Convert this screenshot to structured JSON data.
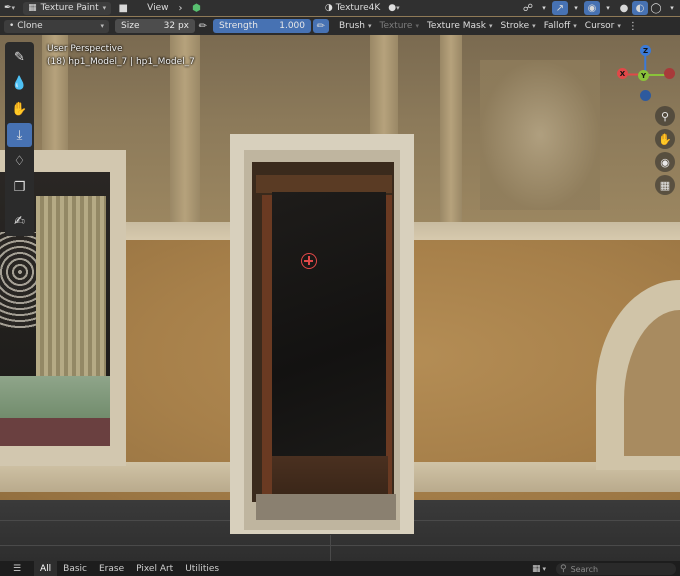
{
  "header": {
    "editor_type_icon": "brush-editor-icon",
    "mode_label": "Texture Paint",
    "view_menu": "View",
    "texture_name": "Texture4K",
    "icons": [
      "orientation-icon",
      "snap-icon",
      "overlay-icon",
      "shading-solid-icon",
      "shading-material-icon",
      "shading-rendered-icon"
    ]
  },
  "tool_header": {
    "brush_name": "Clone",
    "size_label": "Size",
    "size_value": "32 px",
    "strength_label": "Strength",
    "strength_value": "1.000",
    "brush_menu": "Brush",
    "texture_menu": "Texture",
    "texture_mask_menu": "Texture Mask",
    "stroke_menu": "Stroke",
    "falloff_menu": "Falloff",
    "cursor_menu": "Cursor"
  },
  "toolbar": {
    "tools": [
      "draw-tool-icon",
      "soften-tool-icon",
      "smear-tool-icon",
      "clone-tool-icon",
      "fill-tool-icon",
      "mask-tool-icon",
      "annotate-tool-icon"
    ],
    "active_index": 3
  },
  "viewport": {
    "perspective_label": "User Perspective",
    "object_label": "(18) hp1_Model_7 | hp1_Model_7"
  },
  "gizmo": {
    "z_label": "Z",
    "x_label": "X",
    "y_label": "Y",
    "colors": {
      "x": "#e04848",
      "y": "#8ac33a",
      "z": "#3b7ad8"
    }
  },
  "nav_buttons": [
    "zoom-icon",
    "pan-hand-icon",
    "camera-view-icon",
    "grid-view-icon"
  ],
  "bottom": {
    "tabs": [
      "All",
      "Basic",
      "Erase",
      "Pixel Art",
      "Utilities"
    ],
    "active_tab": "All",
    "search_placeholder": "Search"
  }
}
